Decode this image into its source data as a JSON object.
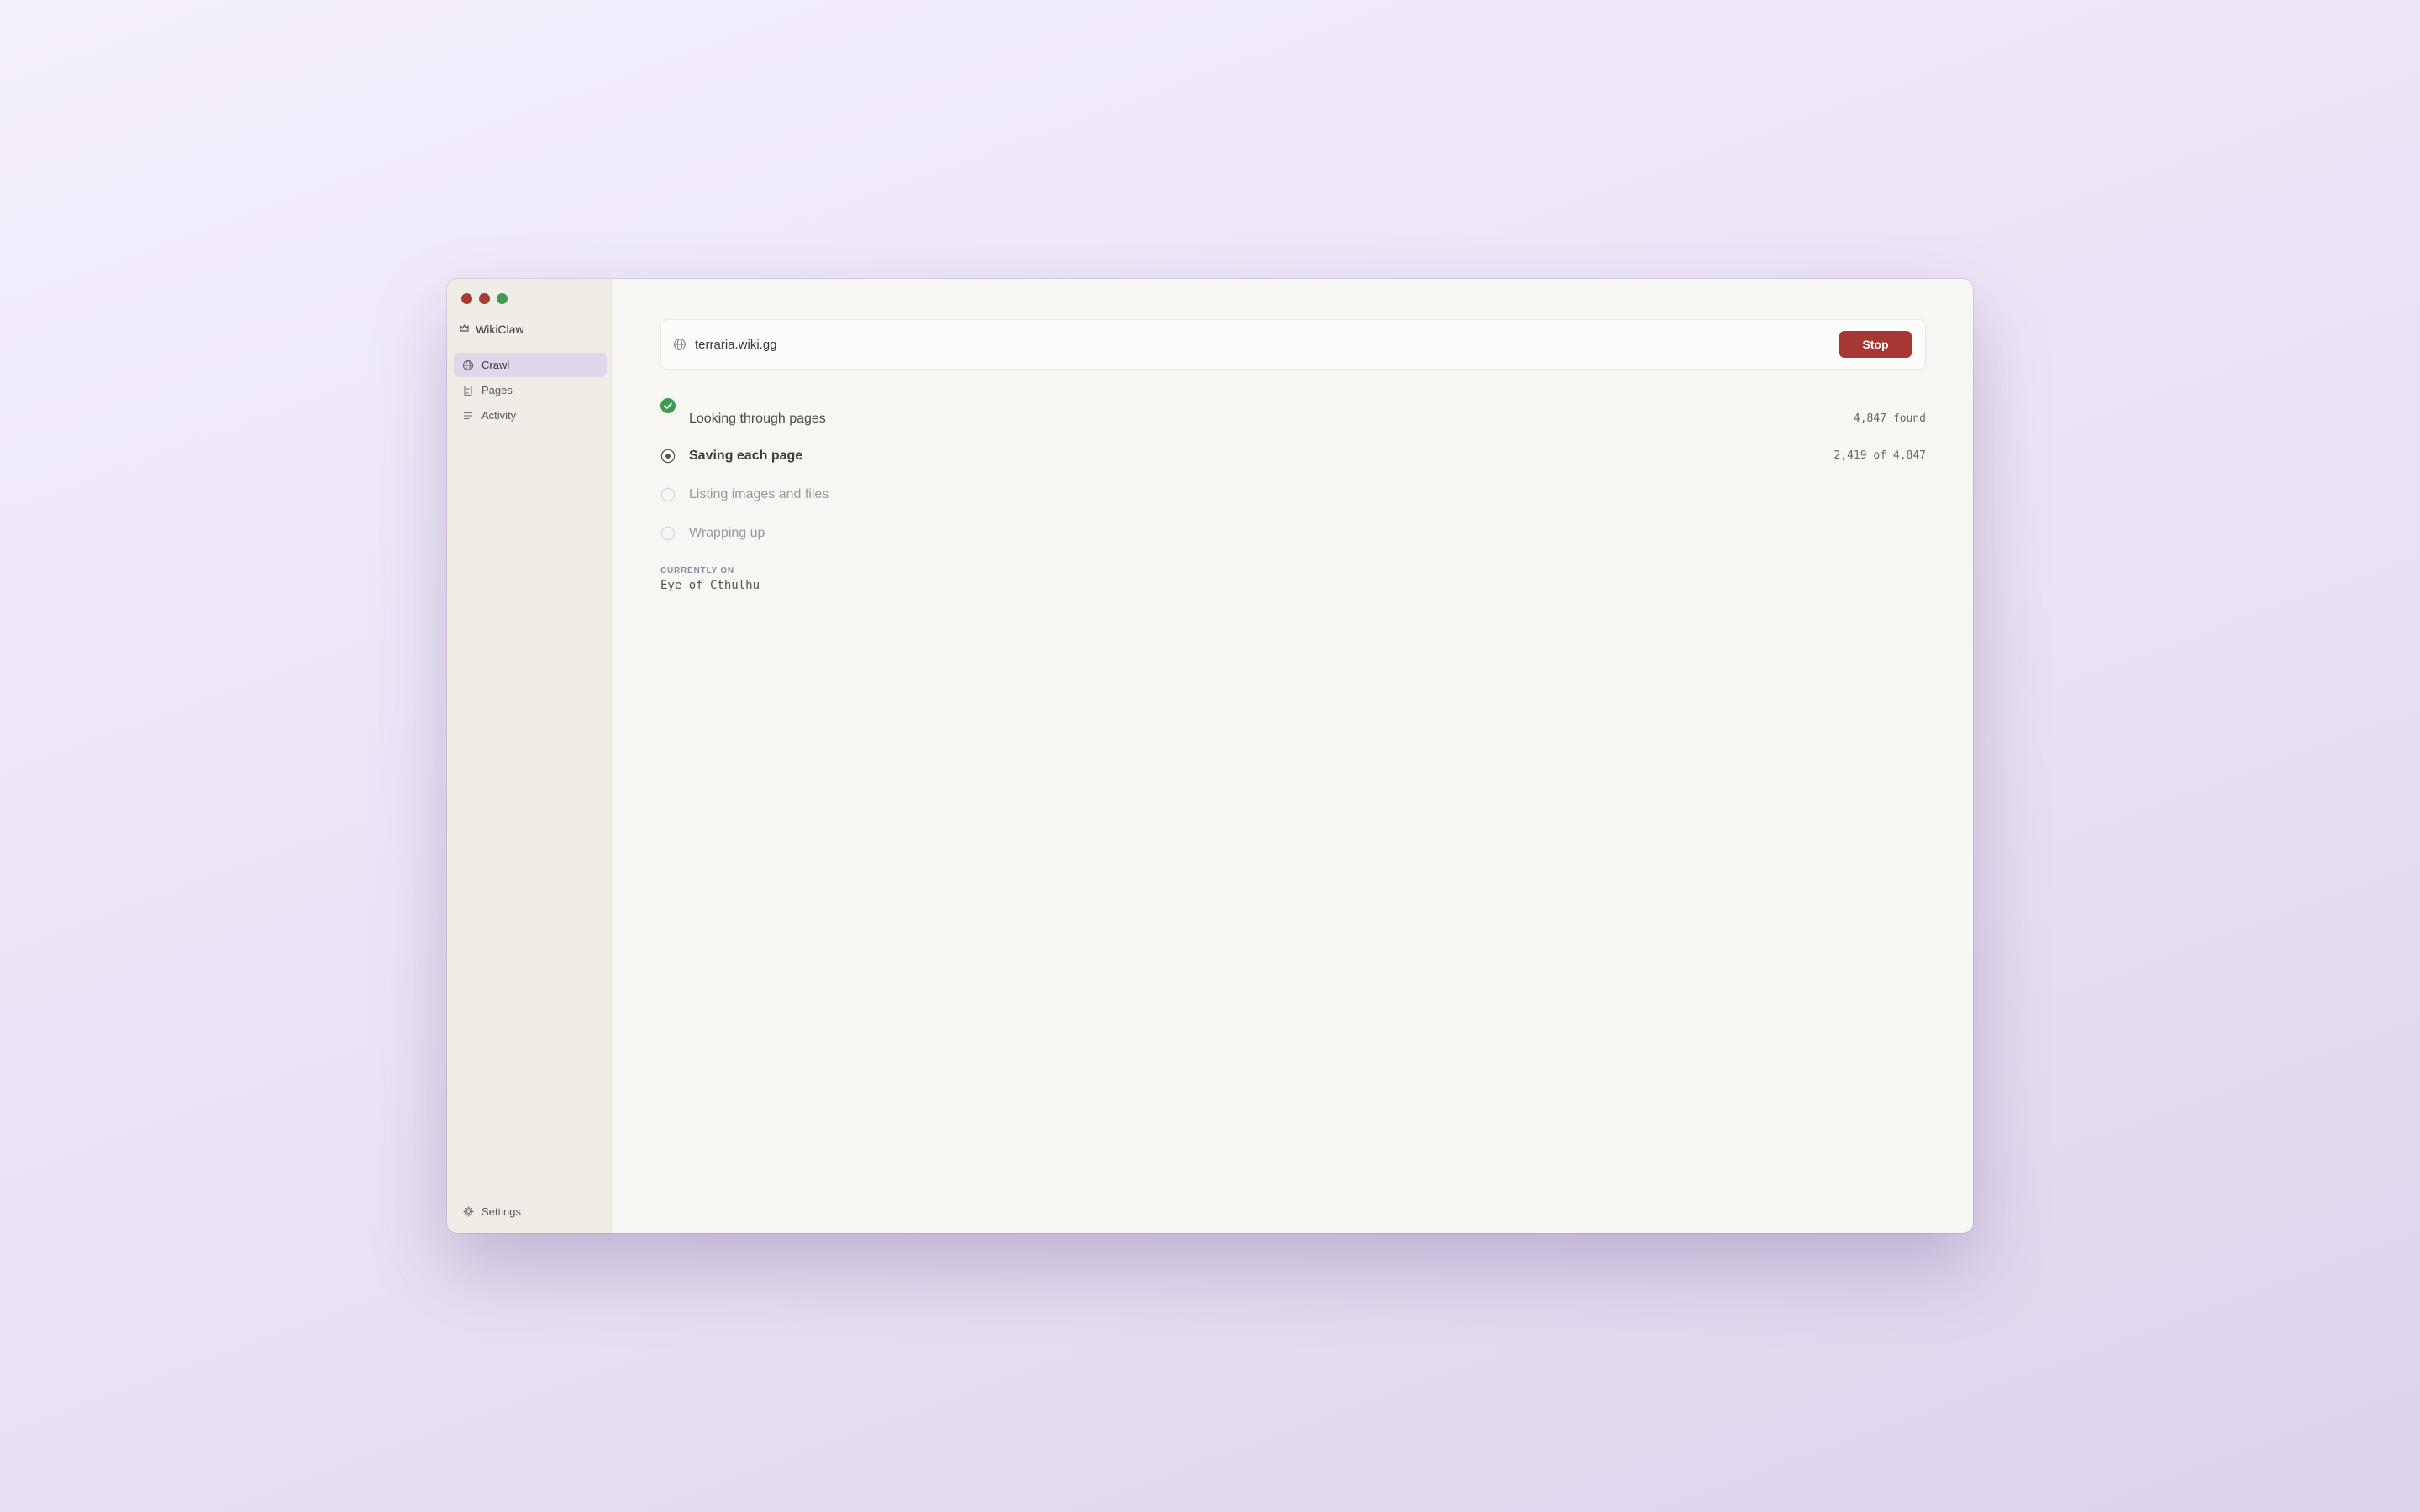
{
  "app": {
    "name": "WikiClaw",
    "brand_icon": "crown-icon"
  },
  "window_controls": {
    "close": "#a63c3a",
    "minimize": "#a63c3a",
    "zoom": "#3f9a52"
  },
  "sidebar": {
    "items": [
      {
        "label": "Crawl",
        "icon": "globe-icon",
        "active": true
      },
      {
        "label": "Pages",
        "icon": "document-icon",
        "active": false
      },
      {
        "label": "Activity",
        "icon": "list-icon",
        "active": false
      }
    ],
    "settings_label": "Settings",
    "settings_icon": "gear-icon"
  },
  "crawl": {
    "url": "terraria.wiki.gg",
    "stop_label": "Stop",
    "stop_color": "#a63732",
    "steps": [
      {
        "label": "Looking through pages",
        "status": "done",
        "count": "4,847 found"
      },
      {
        "label": "Saving each page",
        "status": "active",
        "count": "2,419 of 4,847"
      },
      {
        "label": "Listing images and files",
        "status": "pending",
        "count": ""
      },
      {
        "label": "Wrapping up",
        "status": "pending",
        "count": ""
      }
    ],
    "current_caption": "CURRENTLY ON",
    "current_page": "Eye of Cthulhu"
  },
  "colors": {
    "done": "#3f9a52",
    "active_marker": "#5a5656",
    "pending_marker": "#d9d5dd",
    "sidebar_active_bg": "#e0d8ea"
  }
}
